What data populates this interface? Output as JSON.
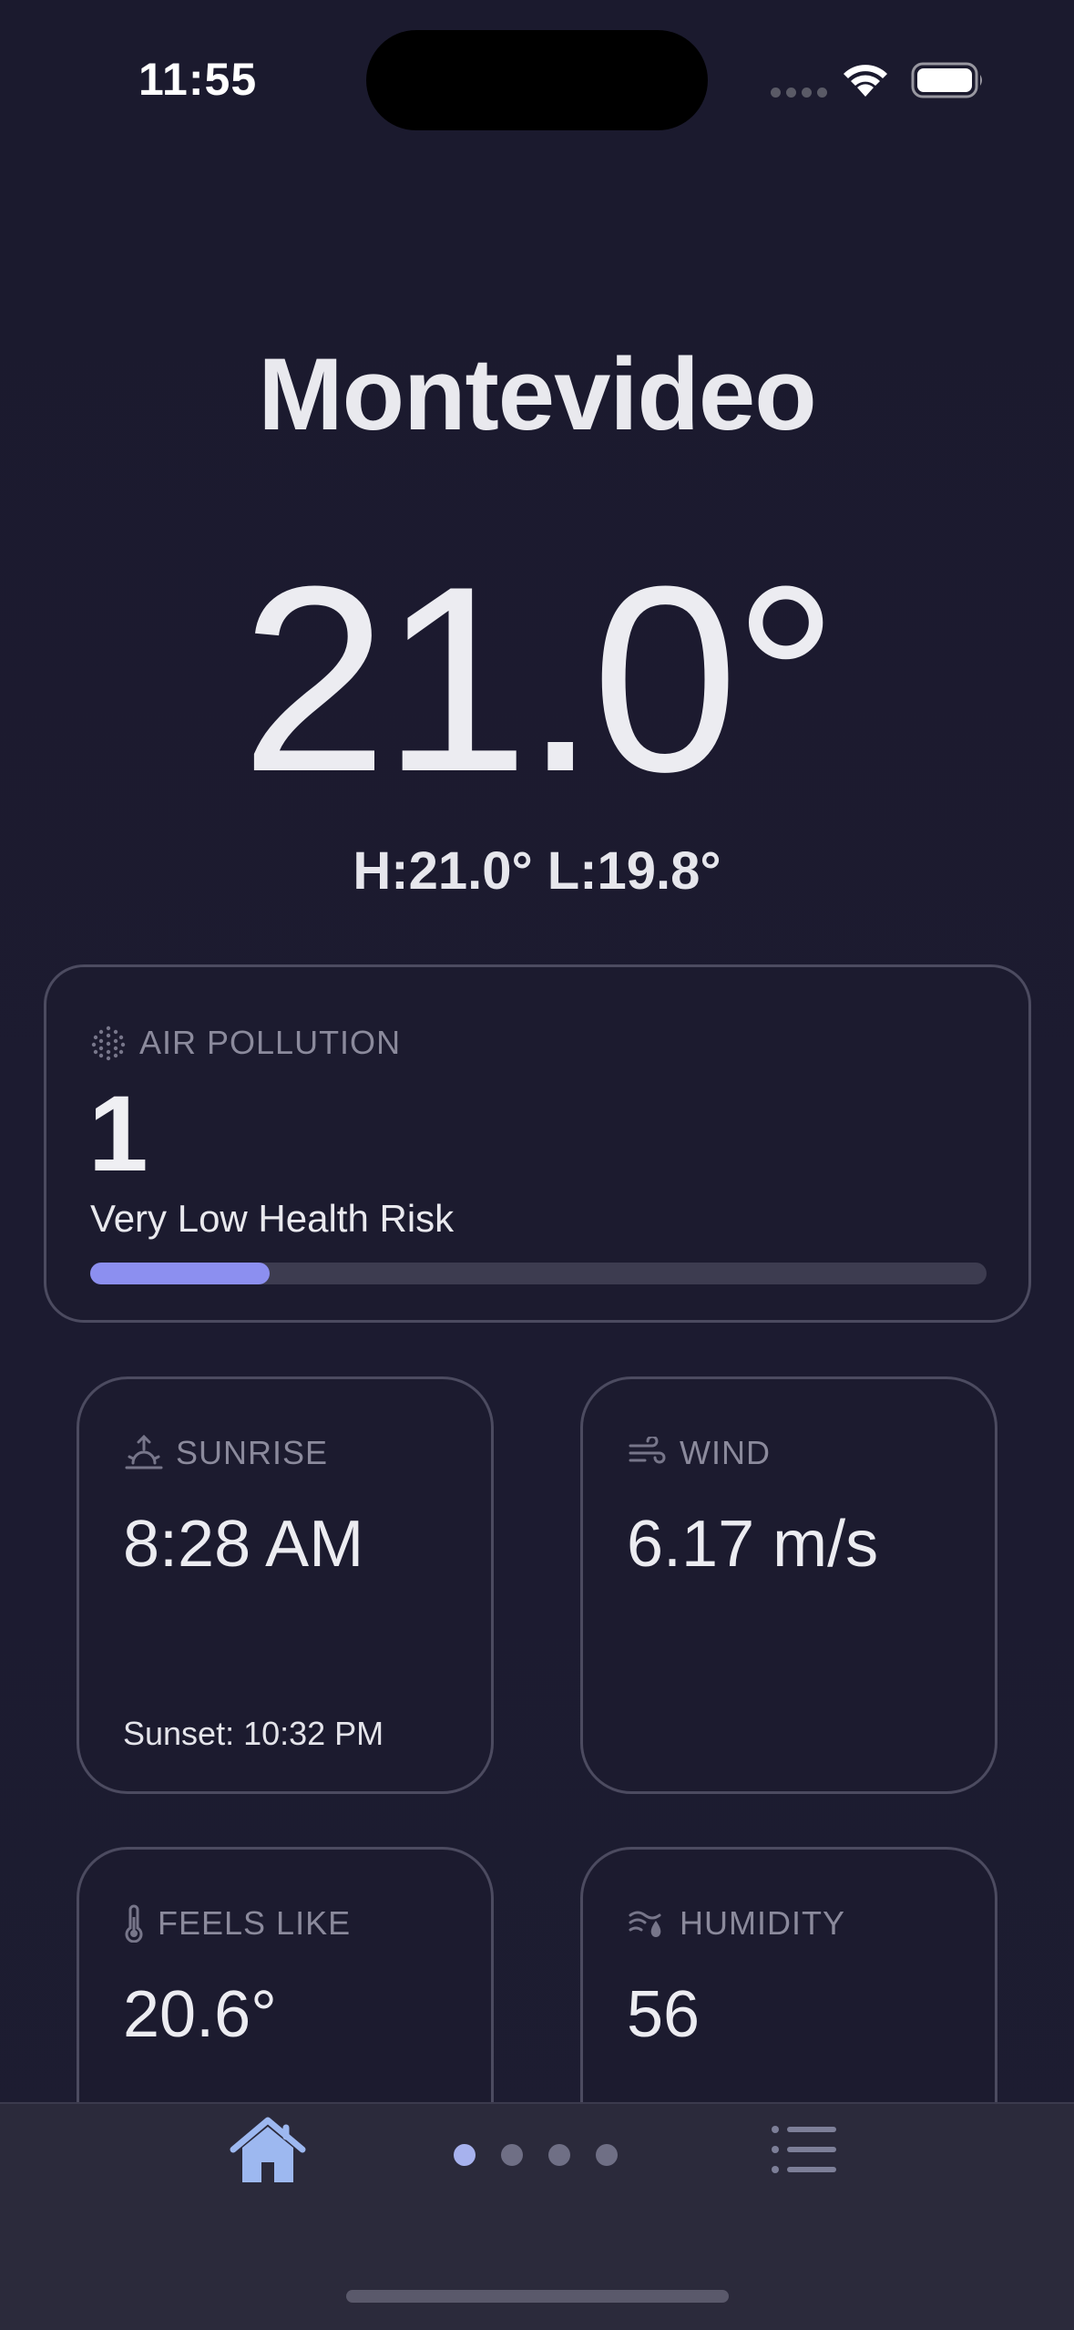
{
  "status_bar": {
    "time": "11:55"
  },
  "location": {
    "city": "Montevideo"
  },
  "current": {
    "temperature": "21.0°",
    "hi_lo": "H:21.0° L:19.8°"
  },
  "air_pollution": {
    "label": "AIR POLLUTION",
    "value": "1",
    "description": "Very Low Health Risk",
    "level_fraction": 0.2,
    "bar_color": "#8c8ff0"
  },
  "sunrise": {
    "label": "SUNRISE",
    "value": "8:28 AM",
    "sunset": "Sunset: 10:32 PM"
  },
  "wind": {
    "label": "WIND",
    "value": "6.17 m/s"
  },
  "feels_like": {
    "label": "FEELS LIKE",
    "value": "20.6°"
  },
  "humidity": {
    "label": "HUMIDITY",
    "value": "56"
  },
  "pager": {
    "pages": 4,
    "active_index": 0
  },
  "icons": {
    "home": "home-icon",
    "list": "list-icon",
    "sunrise": "sunrise-icon",
    "wind": "wind-icon",
    "thermometer": "thermometer-icon",
    "humidity": "humidity-icon",
    "air": "air-particles-icon"
  },
  "colors": {
    "background": "#1a1a2d",
    "accent": "#8c8ff0",
    "home_icon": "#9db8f0"
  }
}
